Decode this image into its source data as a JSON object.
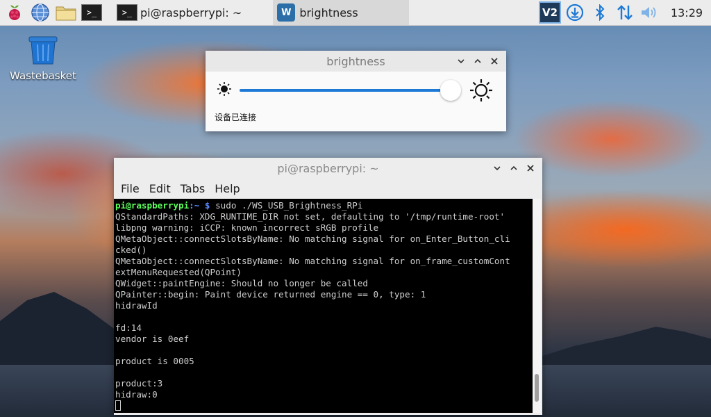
{
  "taskbar": {
    "tasks": [
      {
        "label": "pi@raspberrypi: ~",
        "icon": "terminal-icon"
      },
      {
        "label": "brightness",
        "icon": "waveshare-app-icon"
      }
    ],
    "tray": {
      "vnc_label": "V2",
      "clock": "13:29",
      "icons": [
        "vnc-icon",
        "download-icon",
        "bluetooth-icon",
        "network-icon",
        "volume-icon"
      ]
    },
    "launcher_icons": [
      "raspberry-menu-icon",
      "web-browser-icon",
      "file-manager-icon",
      "terminal-icon"
    ],
    "terminal_glyph": ">_"
  },
  "desktop": {
    "wastebasket_label": "Wastebasket"
  },
  "brightness_window": {
    "title": "brightness",
    "slider_value_fraction": 0.96,
    "status_text": "设备已连接"
  },
  "terminal_window": {
    "title": "pi@raspberrypi: ~",
    "menu": [
      "File",
      "Edit",
      "Tabs",
      "Help"
    ],
    "prompt_user": "pi@raspberrypi",
    "prompt_path": ":~ $",
    "command": " sudo ./WS_USB_Brightness_RPi",
    "output_lines": [
      "QStandardPaths: XDG_RUNTIME_DIR not set, defaulting to '/tmp/runtime-root'",
      "libpng warning: iCCP: known incorrect sRGB profile",
      "QMetaObject::connectSlotsByName: No matching signal for on_Enter_Button_cli",
      "cked()",
      "QMetaObject::connectSlotsByName: No matching signal for on_frame_customCont",
      "extMenuRequested(QPoint)",
      "QWidget::paintEngine: Should no longer be called",
      "QPainter::begin: Paint device returned engine == 0, type: 1",
      "hidrawId",
      "",
      "fd:14",
      "vendor is 0eef",
      "",
      "product is 0005",
      "",
      "product:3",
      "hidraw:0"
    ]
  },
  "colors": {
    "slider_accent": "#1c79d6",
    "prompt_user": "#5cff5c",
    "prompt_path": "#5c8cff",
    "taskbar_bg": "#ececec"
  }
}
